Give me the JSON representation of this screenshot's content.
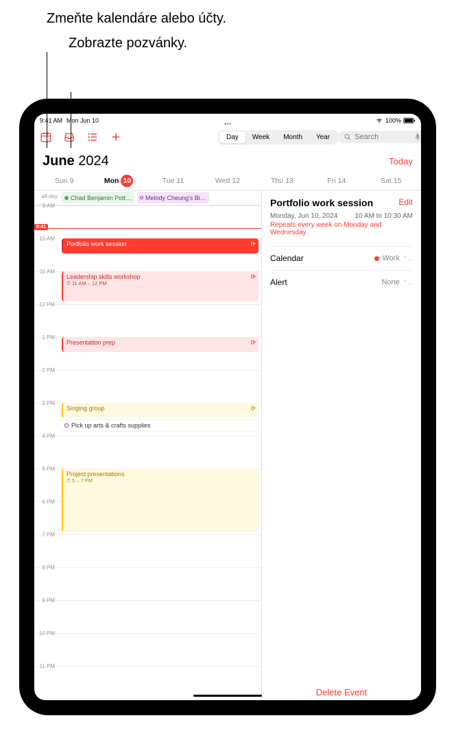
{
  "callouts": {
    "change_calendars": "Zmeňte kalendáre alebo účty.",
    "view_invites": "Zobrazte pozvánky."
  },
  "status": {
    "time": "9:41 AM",
    "date": "Mon Jun 10",
    "battery": "100%"
  },
  "toolbar": {
    "search_placeholder": "Search"
  },
  "view_segments": {
    "day": "Day",
    "week": "Week",
    "month": "Month",
    "year": "Year"
  },
  "header": {
    "month": "June",
    "year": "2024",
    "today": "Today"
  },
  "days": [
    {
      "name": "Sun",
      "num": "9"
    },
    {
      "name": "Mon",
      "num": "10",
      "today": true
    },
    {
      "name": "Tue",
      "num": "11"
    },
    {
      "name": "Wed",
      "num": "12"
    },
    {
      "name": "Thu",
      "num": "13"
    },
    {
      "name": "Fri",
      "num": "14"
    },
    {
      "name": "Sat",
      "num": "15"
    }
  ],
  "allday": {
    "label": "all-day",
    "events": [
      {
        "title": "Chad Benjamin Pott…"
      },
      {
        "title": "Melody Cheung's Bi…"
      }
    ]
  },
  "now_time": "9:41",
  "hours": [
    "9 AM",
    "10 AM",
    "11 AM",
    "12 PM",
    "1 PM",
    "2 PM",
    "3 PM",
    "4 PM",
    "5 PM",
    "6 PM",
    "7 PM",
    "8 PM",
    "9 PM",
    "10 PM",
    "11 PM"
  ],
  "events": {
    "portfolio": {
      "title": "Portfolio work session"
    },
    "leadership": {
      "title": "Leadership skills workshop",
      "sub": "11 AM – 12 PM"
    },
    "presentation": {
      "title": "Presentation prep"
    },
    "singing": {
      "title": "Singing group"
    },
    "pickup": {
      "title": "Pick up arts & crafts supplies"
    },
    "project": {
      "title": "Project presentations",
      "sub": "5 – 7 PM"
    }
  },
  "detail": {
    "title": "Portfolio work session",
    "edit": "Edit",
    "date": "Monday, Jun 10, 2024",
    "time": "10 AM to 10:30 AM",
    "repeat": "Repeats every week on Monday and Wednesday",
    "calendar_label": "Calendar",
    "calendar_value": "Work",
    "alert_label": "Alert",
    "alert_value": "None",
    "delete": "Delete Event"
  }
}
